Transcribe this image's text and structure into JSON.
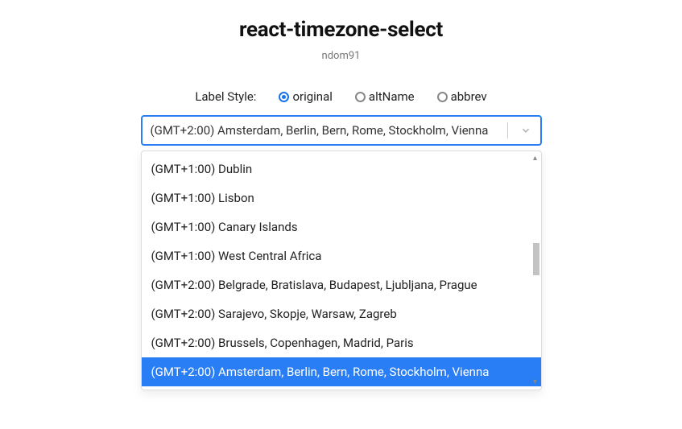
{
  "header": {
    "title": "react-timezone-select",
    "author": "ndom91"
  },
  "labelStyle": {
    "label": "Label Style:",
    "selected": "original",
    "options": [
      {
        "value": "original",
        "label": "original"
      },
      {
        "value": "altName",
        "label": "altName"
      },
      {
        "value": "abbrev",
        "label": "abbrev"
      }
    ]
  },
  "select": {
    "value": "(GMT+2:00) Amsterdam, Berlin, Bern, Rome, Stockholm, Vienna",
    "options": [
      "(GMT+1:00) Dublin",
      "(GMT+1:00) Lisbon",
      "(GMT+1:00) Canary Islands",
      "(GMT+1:00) West Central Africa",
      "(GMT+2:00) Belgrade, Bratislava, Budapest, Ljubljana, Prague",
      "(GMT+2:00) Sarajevo, Skopje, Warsaw, Zagreb",
      "(GMT+2:00) Brussels, Copenhagen, Madrid, Paris",
      "(GMT+2:00) Amsterdam, Berlin, Bern, Rome, Stockholm, Vienna"
    ],
    "selectedIndex": 7
  }
}
